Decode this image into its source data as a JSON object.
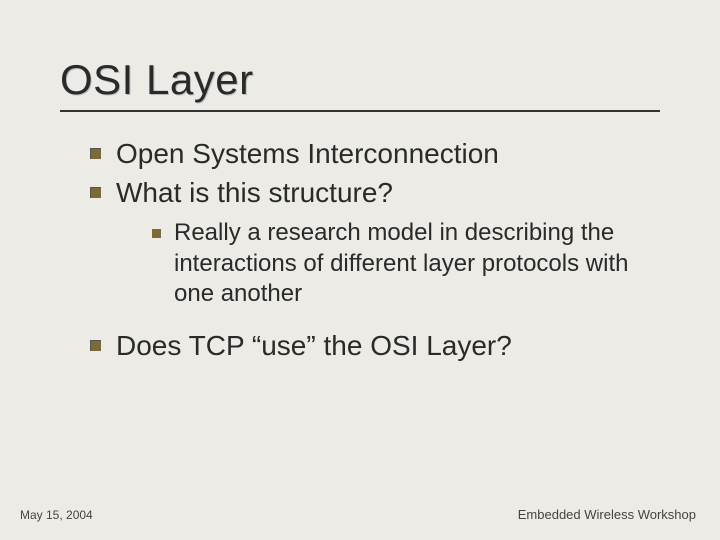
{
  "slide": {
    "title": "OSI Layer",
    "bullets": {
      "b1": "Open Systems Interconnection",
      "b2": "What is this structure?",
      "b2_1": "Really a research model in describing the interactions of different layer protocols with one another",
      "b3": "Does TCP “use” the OSI Layer?"
    },
    "footer": {
      "date": "May 15, 2004",
      "event": "Embedded Wireless Workshop"
    }
  }
}
